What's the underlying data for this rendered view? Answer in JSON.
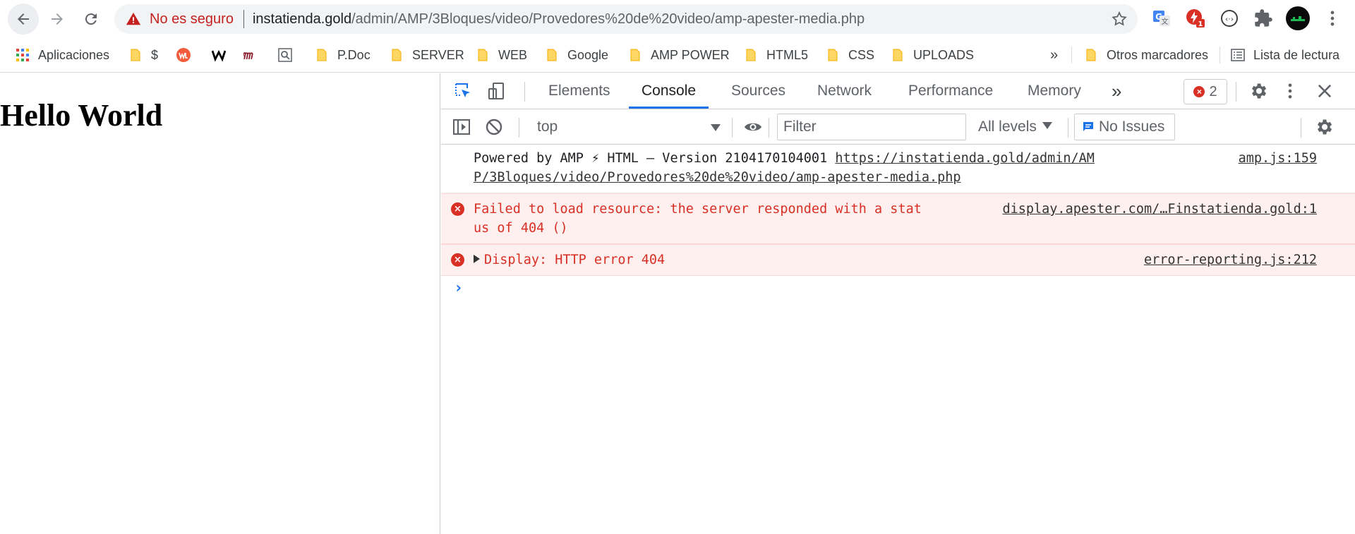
{
  "address_bar": {
    "security_status": "No es seguro",
    "url_host": "instatienda.gold",
    "url_path": "/admin/AMP/3Bloques/video/Provedores%20de%20video/amp-apester-media.php"
  },
  "extensions": {
    "badge_count": "1"
  },
  "bookmarks": {
    "apps_label": "Aplicaciones",
    "items": [
      "$",
      "P.Doc",
      "SERVER",
      "WEB",
      "Google",
      "AMP POWER",
      "HTML5",
      "CSS",
      "UPLOADS"
    ],
    "overflow": "»",
    "other": "Otros marcadores",
    "reading_list": "Lista de lectura"
  },
  "page": {
    "heading": "Hello World"
  },
  "devtools": {
    "tabs": [
      "Elements",
      "Console",
      "Sources",
      "Network",
      "Performance",
      "Memory"
    ],
    "active_tab": "Console",
    "more_tabs": "»",
    "error_count": "2",
    "context": "top",
    "filter_placeholder": "Filter",
    "levels": "All levels",
    "issues": "No Issues",
    "messages": [
      {
        "type": "log",
        "text": "Powered by AMP ⚡ HTML – Version 2104170104001 ",
        "link": "https://instatienda.gold/admin/AMP/3Bloques/video/Provedores%20de%20video/amp-apester-media.php",
        "source": "amp.js:159"
      },
      {
        "type": "error",
        "text": "Failed to load resource: the server responded with a status of 404 ()",
        "source": "display.apester.com/…Finstatienda.gold:1"
      },
      {
        "type": "error",
        "text": "Display: HTTP error 404",
        "source": "error-reporting.js:212"
      }
    ],
    "prompt": "›"
  },
  "colors": {
    "accent": "#1a73e8",
    "error": "#d93025",
    "error_bg": "#fff0f0"
  }
}
